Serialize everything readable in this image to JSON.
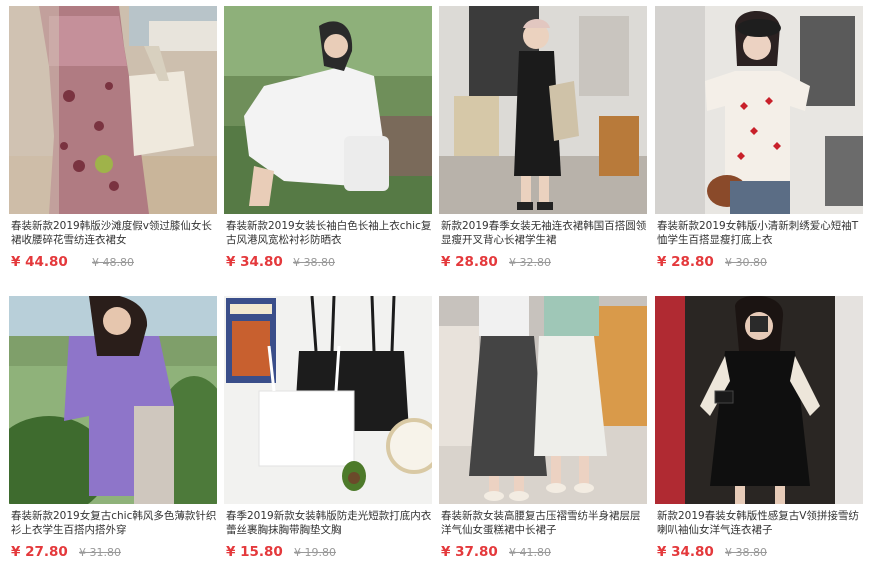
{
  "colors": {
    "price": "#e4393c",
    "old_price": "#999999",
    "title": "#333333"
  },
  "products": [
    {
      "title": "春装新款2019韩版沙滩度假v领过膝仙女长裙收腰碎花雪纺连衣裙女",
      "price": "¥ 44.80",
      "old_price": "¥ 48.80"
    },
    {
      "title": "春装新款2019女装长袖白色长袖上衣chic复古风港风宽松衬衫防晒衣",
      "price": "¥ 34.80",
      "old_price": "¥ 38.80"
    },
    {
      "title": "新款2019春季女装无袖连衣裙韩国百搭圆领显瘦开叉背心长裙学生裙",
      "price": "¥ 28.80",
      "old_price": "¥ 32.80"
    },
    {
      "title": "春装新款2019女韩版小清新刺绣爱心短袖T恤学生百搭显瘦打底上衣",
      "price": "¥ 28.80",
      "old_price": "¥ 30.80"
    },
    {
      "title": "春装新款2019女复古chic韩风多色薄款针织衫上衣学生百搭内搭外穿",
      "price": "¥ 27.80",
      "old_price": "¥ 31.80"
    },
    {
      "title": "春季2019新款女装韩版防走光短款打底内衣蕾丝裹胸抹胸带胸垫文胸",
      "price": "¥ 15.80",
      "old_price": "¥ 19.80"
    },
    {
      "title": "春装新款女装高腰复古压褶雪纺半身裙层层洋气仙女蛋糕裙中长裙子",
      "price": "¥ 37.80",
      "old_price": "¥ 41.80"
    },
    {
      "title": "新款2019春装女韩版性感复古V领拼接雪纺喇叭袖仙女洋气连衣裙子",
      "price": "¥ 34.80",
      "old_price": "¥ 38.80"
    }
  ]
}
